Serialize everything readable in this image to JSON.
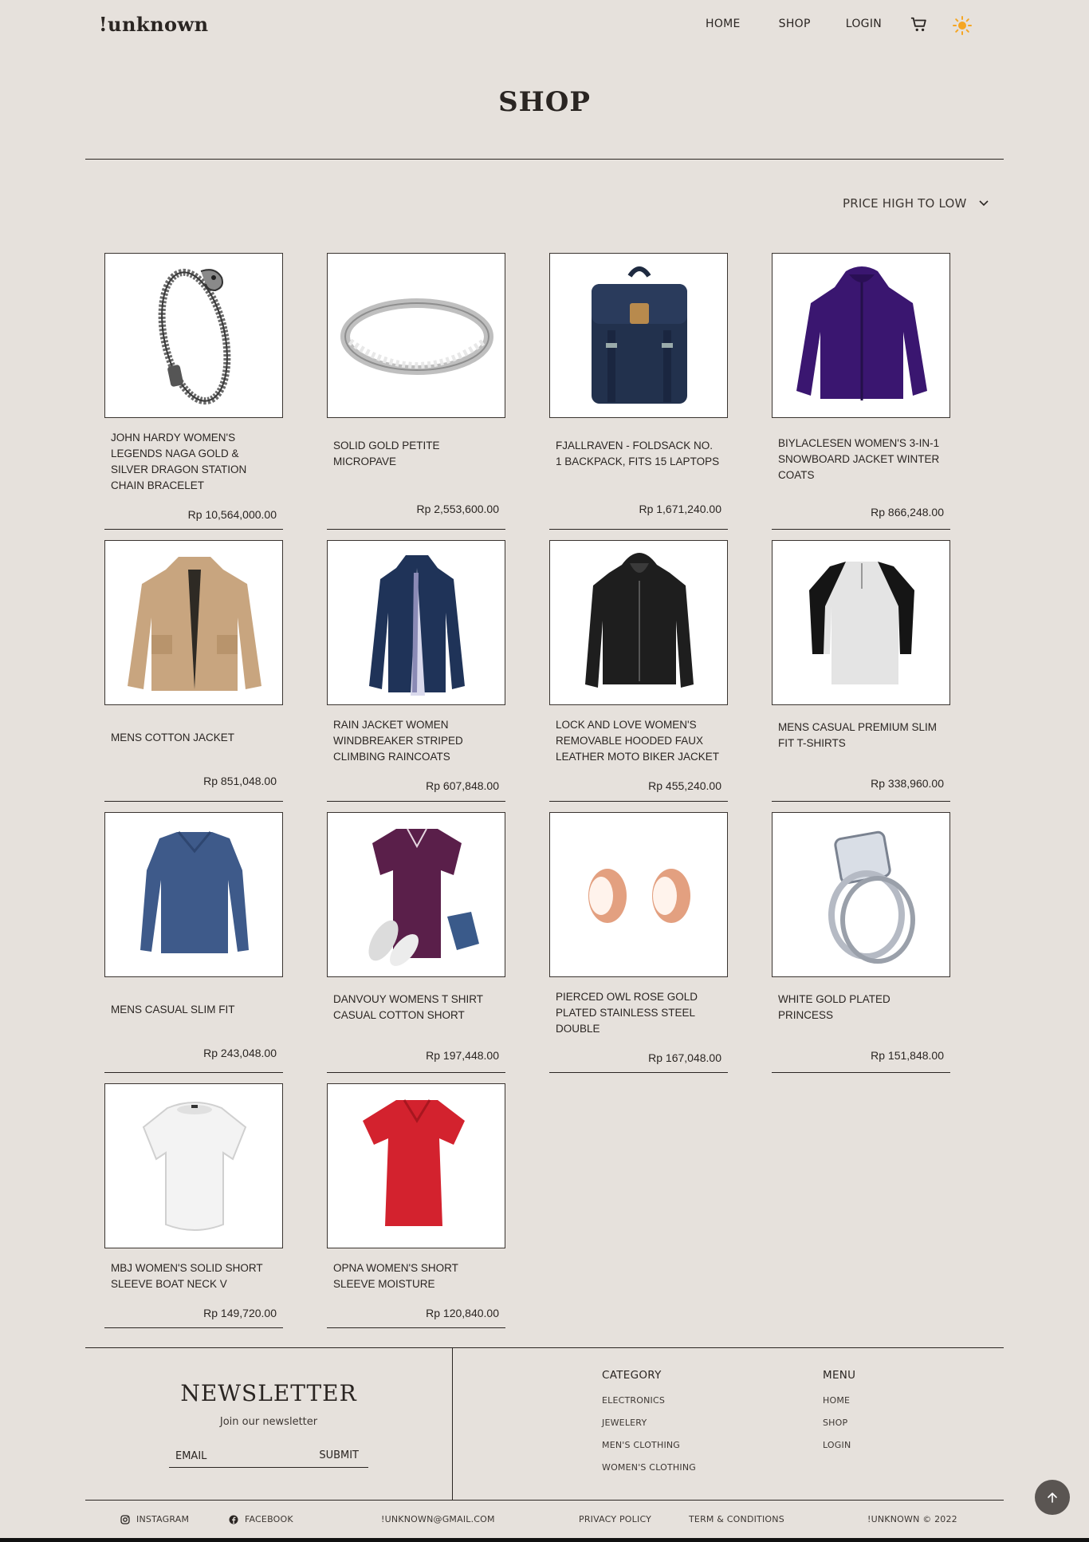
{
  "brand": "!unknown",
  "nav": {
    "home": "HOME",
    "shop": "SHOP",
    "login": "LOGIN"
  },
  "icons": {
    "cart": "cart-icon",
    "theme": "sun-icon",
    "accent": "#f5a623"
  },
  "page_title": "SHOP",
  "sort": {
    "label": "PRICE HIGH TO LOW"
  },
  "products": [
    {
      "title": "JOHN HARDY WOMEN'S LEGENDS NAGA GOLD & SILVER DRAGON STATION CHAIN BRACELET",
      "price": "Rp 10,564,000.00",
      "image": "bracelet"
    },
    {
      "title": "SOLID GOLD PETITE MICROPAVE",
      "price": "Rp 2,553,600.00",
      "image": "ring"
    },
    {
      "title": "FJALLRAVEN - FOLDSACK NO. 1 BACKPACK, FITS 15 LAPTOPS",
      "price": "Rp 1,671,240.00",
      "image": "backpack"
    },
    {
      "title": "BIYLACLESEN WOMEN'S 3-IN-1 SNOWBOARD JACKET WINTER COATS",
      "price": "Rp 866,248.00",
      "image": "purple-jacket"
    },
    {
      "title": "MENS COTTON JACKET",
      "price": "Rp 851,048.00",
      "image": "cotton-jacket"
    },
    {
      "title": "RAIN JACKET WOMEN WINDBREAKER STRIPED CLIMBING RAINCOATS",
      "price": "Rp 607,848.00",
      "image": "rain-jacket"
    },
    {
      "title": "LOCK AND LOVE WOMEN'S REMOVABLE HOODED FAUX LEATHER MOTO BIKER JACKET",
      "price": "Rp 455,240.00",
      "image": "leather-jacket"
    },
    {
      "title": "MENS CASUAL PREMIUM SLIM FIT T-SHIRTS",
      "price": "Rp 338,960.00",
      "image": "raglan-tee"
    },
    {
      "title": "MENS CASUAL SLIM FIT",
      "price": "Rp 243,048.00",
      "image": "longsleeve"
    },
    {
      "title": "DANVOUY WOMENS T SHIRT CASUAL COTTON SHORT",
      "price": "Rp 197,448.00",
      "image": "purple-tee"
    },
    {
      "title": "PIERCED OWL ROSE GOLD PLATED STAINLESS STEEL DOUBLE",
      "price": "Rp 167,048.00",
      "image": "plugs"
    },
    {
      "title": "WHITE GOLD PLATED PRINCESS",
      "price": "Rp 151,848.00",
      "image": "diamond-ring"
    },
    {
      "title": "MBJ WOMEN'S SOLID SHORT SLEEVE BOAT NECK V",
      "price": "Rp 149,720.00",
      "image": "white-tee"
    },
    {
      "title": "OPNA WOMEN'S SHORT SLEEVE MOISTURE",
      "price": "Rp 120,840.00",
      "image": "red-tee"
    }
  ],
  "footer": {
    "newsletter_title": "NEWSLETTER",
    "newsletter_sub": "Join our newsletter",
    "email_placeholder": "EMAIL",
    "submit": "SUBMIT",
    "category_head": "CATEGORY",
    "categories": [
      "ELECTRONICS",
      "JEWELERY",
      "MEN'S CLOTHING",
      "WOMEN'S CLOTHING"
    ],
    "menu_head": "MENU",
    "menu": [
      "HOME",
      "SHOP",
      "LOGIN"
    ],
    "instagram": "INSTAGRAM",
    "facebook": "FACEBOOK",
    "email": "!UNKNOWN@GMAIL.COM",
    "privacy": "PRIVACY POLICY",
    "terms": "TERM & CONDITIONS",
    "copyright": "!UNKNOWN © 2022"
  }
}
